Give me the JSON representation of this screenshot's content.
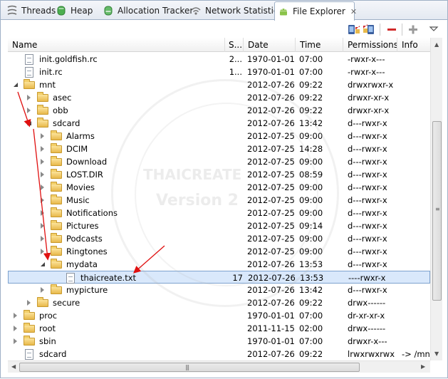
{
  "tabs": [
    {
      "label": "Threads",
      "icon": "threads-icon"
    },
    {
      "label": "Heap",
      "icon": "heap-icon"
    },
    {
      "label": "Allocation Tracker",
      "icon": "allocation-tracker-icon"
    },
    {
      "label": "Network Statistics",
      "icon": "network-statistics-icon"
    },
    {
      "label": "File Explorer",
      "icon": "android-icon",
      "active": true,
      "close": "✕"
    }
  ],
  "toolbar": {
    "pull_icon": "pull-file-from-device-icon",
    "push_icon": "push-file-onto-device-icon",
    "delete_icon": "delete-icon",
    "add_icon": "new-folder-icon",
    "menu_icon": "view-menu-chevron-icon"
  },
  "columns": [
    "Name",
    "S...",
    "Date",
    "Time",
    "Permissions",
    "Info"
  ],
  "rows": [
    {
      "name": "init.goldfish.rc",
      "type": "file",
      "depth": 0,
      "size": "2...",
      "date": "1970-01-01",
      "time": "07:00",
      "perm": "-rwxr-x---",
      "info": ""
    },
    {
      "name": "init.rc",
      "type": "file",
      "depth": 0,
      "size": "1...",
      "date": "1970-01-01",
      "time": "07:00",
      "perm": "-rwxr-x---",
      "info": ""
    },
    {
      "name": "mnt",
      "type": "folder",
      "depth": 0,
      "expanded": true,
      "size": "",
      "date": "2012-07-26",
      "time": "09:22",
      "perm": "drwxrwxr-x",
      "info": ""
    },
    {
      "name": "asec",
      "type": "folder",
      "depth": 1,
      "size": "",
      "date": "2012-07-26",
      "time": "09:22",
      "perm": "drwxr-xr-x",
      "info": ""
    },
    {
      "name": "obb",
      "type": "folder",
      "depth": 1,
      "size": "",
      "date": "2012-07-26",
      "time": "09:22",
      "perm": "drwxr-xr-x",
      "info": ""
    },
    {
      "name": "sdcard",
      "type": "folder",
      "depth": 1,
      "expanded": true,
      "size": "",
      "date": "2012-07-26",
      "time": "13:42",
      "perm": "d---rwxr-x",
      "info": ""
    },
    {
      "name": "Alarms",
      "type": "folder",
      "depth": 2,
      "size": "",
      "date": "2012-07-25",
      "time": "09:00",
      "perm": "d---rwxr-x",
      "info": ""
    },
    {
      "name": "DCIM",
      "type": "folder",
      "depth": 2,
      "size": "",
      "date": "2012-07-25",
      "time": "14:28",
      "perm": "d---rwxr-x",
      "info": ""
    },
    {
      "name": "Download",
      "type": "folder",
      "depth": 2,
      "size": "",
      "date": "2012-07-25",
      "time": "09:00",
      "perm": "d---rwxr-x",
      "info": ""
    },
    {
      "name": "LOST.DIR",
      "type": "folder",
      "depth": 2,
      "size": "",
      "date": "2012-07-25",
      "time": "08:59",
      "perm": "d---rwxr-x",
      "info": ""
    },
    {
      "name": "Movies",
      "type": "folder",
      "depth": 2,
      "size": "",
      "date": "2012-07-25",
      "time": "09:00",
      "perm": "d---rwxr-x",
      "info": ""
    },
    {
      "name": "Music",
      "type": "folder",
      "depth": 2,
      "size": "",
      "date": "2012-07-25",
      "time": "09:00",
      "perm": "d---rwxr-x",
      "info": ""
    },
    {
      "name": "Notifications",
      "type": "folder",
      "depth": 2,
      "size": "",
      "date": "2012-07-25",
      "time": "09:00",
      "perm": "d---rwxr-x",
      "info": ""
    },
    {
      "name": "Pictures",
      "type": "folder",
      "depth": 2,
      "size": "",
      "date": "2012-07-25",
      "time": "09:14",
      "perm": "d---rwxr-x",
      "info": ""
    },
    {
      "name": "Podcasts",
      "type": "folder",
      "depth": 2,
      "size": "",
      "date": "2012-07-25",
      "time": "09:00",
      "perm": "d---rwxr-x",
      "info": ""
    },
    {
      "name": "Ringtones",
      "type": "folder",
      "depth": 2,
      "size": "",
      "date": "2012-07-25",
      "time": "09:00",
      "perm": "d---rwxr-x",
      "info": ""
    },
    {
      "name": "mydata",
      "type": "folder",
      "depth": 2,
      "expanded": true,
      "size": "",
      "date": "2012-07-26",
      "time": "13:53",
      "perm": "d---rwxr-x",
      "info": ""
    },
    {
      "name": "thaicreate.txt",
      "type": "file",
      "depth": 3,
      "selected": true,
      "size": "17",
      "date": "2012-07-26",
      "time": "13:53",
      "perm": "----rwxr-x",
      "info": ""
    },
    {
      "name": "mypicture",
      "type": "folder",
      "depth": 2,
      "size": "",
      "date": "2012-07-26",
      "time": "13:42",
      "perm": "d---rwxr-x",
      "info": ""
    },
    {
      "name": "secure",
      "type": "folder",
      "depth": 1,
      "size": "",
      "date": "2012-07-26",
      "time": "09:22",
      "perm": "drwx------",
      "info": ""
    },
    {
      "name": "proc",
      "type": "folder",
      "depth": 0,
      "size": "",
      "date": "1970-01-01",
      "time": "07:00",
      "perm": "dr-xr-xr-x",
      "info": ""
    },
    {
      "name": "root",
      "type": "folder",
      "depth": 0,
      "size": "",
      "date": "2011-11-15",
      "time": "02:00",
      "perm": "drwx------",
      "info": ""
    },
    {
      "name": "sbin",
      "type": "folder",
      "depth": 0,
      "size": "",
      "date": "1970-01-01",
      "time": "07:00",
      "perm": "drwxr-x---",
      "info": ""
    },
    {
      "name": "sdcard",
      "type": "file",
      "depth": 0,
      "size": "",
      "date": "2012-07-26",
      "time": "09:22",
      "perm": "lrwxrwxrwx",
      "info": "-> /mn"
    }
  ],
  "watermark": {
    "line1": "THAICREATE",
    "line2": "Version 2"
  },
  "colors": {
    "selection": "#d9e8fb",
    "arrow": "#e01010",
    "delete": "#d12a2a"
  }
}
